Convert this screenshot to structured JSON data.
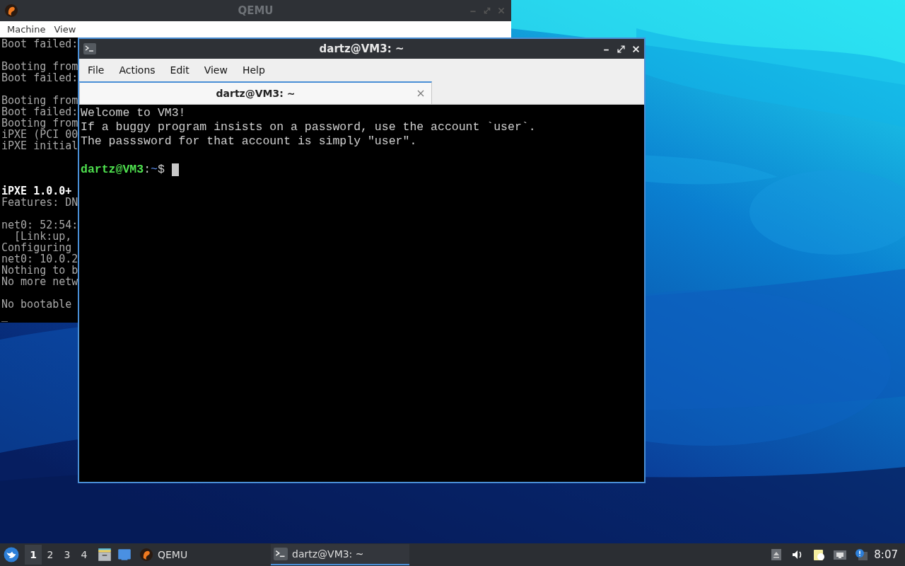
{
  "qemu_window": {
    "title": "QEMU",
    "menu": [
      "Machine",
      "View"
    ],
    "console_lines": [
      {
        "kind": "text",
        "text": "Boot failed:",
        "bright": false
      },
      {
        "kind": "blank"
      },
      {
        "kind": "text",
        "text": "Booting from",
        "bright": false
      },
      {
        "kind": "text",
        "text": "Boot failed:",
        "bright": false
      },
      {
        "kind": "blank"
      },
      {
        "kind": "text",
        "text": "Booting from",
        "bright": false
      },
      {
        "kind": "text",
        "text": "Boot failed:",
        "bright": false
      },
      {
        "kind": "text",
        "text": "Booting from",
        "bright": false
      },
      {
        "kind": "text",
        "text": "iPXE (PCI 00",
        "bright": false
      },
      {
        "kind": "text",
        "text": "iPXE initial",
        "bright": false
      },
      {
        "kind": "blank"
      },
      {
        "kind": "blank"
      },
      {
        "kind": "blank"
      },
      {
        "kind": "text",
        "text": "iPXE 1.0.0+",
        "bright": true
      },
      {
        "kind": "text",
        "text": "Features: DN",
        "bright": false
      },
      {
        "kind": "blank"
      },
      {
        "kind": "text",
        "text": "net0: 52:54:",
        "bright": false
      },
      {
        "kind": "text",
        "text": "  [Link:up,",
        "bright": false
      },
      {
        "kind": "text",
        "text": "Configuring",
        "bright": false
      },
      {
        "kind": "text",
        "text": "net0: 10.0.2",
        "bright": false
      },
      {
        "kind": "text",
        "text": "Nothing to b",
        "bright": false
      },
      {
        "kind": "text",
        "text": "No more netw",
        "bright": false
      },
      {
        "kind": "blank"
      },
      {
        "kind": "text",
        "text": "No bootable",
        "bright": false
      },
      {
        "kind": "text",
        "text": "_",
        "bright": false
      }
    ]
  },
  "terminal_window": {
    "title": "dartz@VM3: ~",
    "menu": [
      "File",
      "Actions",
      "Edit",
      "View",
      "Help"
    ],
    "tabs": [
      {
        "label": "dartz@VM3: ~",
        "selected": true
      }
    ],
    "output_lines": [
      "Welcome to VM3!",
      "If a buggy program insists on a password, use the account `user`.",
      "The passsword for that account is simply \"user\"."
    ],
    "prompt": {
      "user_host": "dartz@VM3",
      "separator": ":",
      "path": "~",
      "symbol": "$"
    }
  },
  "taskbar": {
    "workspaces": [
      {
        "label": "1",
        "selected": true
      },
      {
        "label": "2",
        "selected": false
      },
      {
        "label": "3",
        "selected": false
      },
      {
        "label": "4",
        "selected": false
      }
    ],
    "tasks": [
      {
        "label": "QEMU",
        "kind": "qemu",
        "selected": false
      },
      {
        "label": "dartz@VM3: ~",
        "kind": "terminal",
        "selected": true
      }
    ],
    "clock": "8:07"
  }
}
